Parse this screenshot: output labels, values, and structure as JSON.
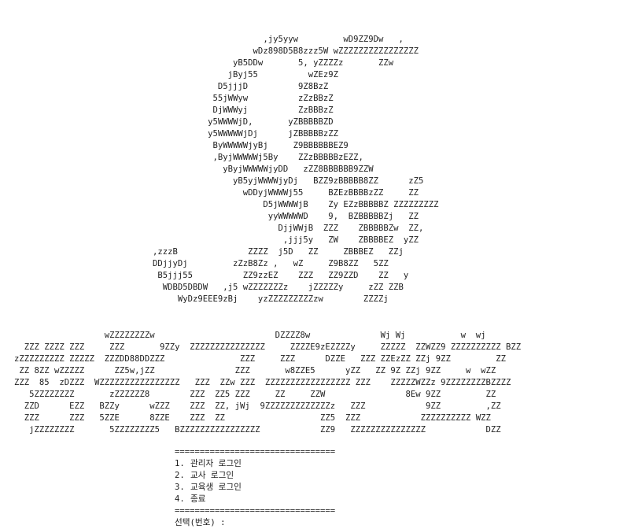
{
  "art": {
    "sun": "                      ,jy5yyw         wD9ZZ9Dw   ,\n                    wDz898D5B8zzz5W wZZZZZZZZZZZZZZZZ\n                yB5DDw       5, yZZZZz       ZZw\n               jByj55          wZEz9Z\n             D5jjjD          9Z8BzZ\n            55jWWyw          zZzBBzZ\n            DjWWWyj          ZzBBBzZ\n           y5WWWWjD,       yZBBBBBZD\n           y5WWWWWjDj      jZBBBBBzZZ\n            ByWWWWWjyBj     Z9BBBBBBEZ9\n            ,ByjWWWWWj5By    ZZzBBBBBzEZZ,\n              yByjWWWWWjyDD   zZZ8BBBBBB9ZZW\n                yB5yjWWWWjyDj   BZZ9zBBBBB8ZZ      zZ5\n                  wDDyjWWWWj55     BZEzBBBBzZZ     ZZ\n                      D5jWWWWjB    Zy EZzBBBBBZ ZZZZZZZZZ\n                       yyWWWWWD    9,  BZBBBBBZj   ZZ\n                         DjjWWjB  ZZZ    ZBBBBBZw  ZZ,\n                          ,jjj5y   ZW    ZBBBBEZ  yZZ\n,zzzB              ZZZZ  j5D   ZZ     ZBBBEZ   ZZj\nDDjjyDj         zZzB8Zz ,   wZ     Z9B8ZZ   5ZZ\n B5jjj55          ZZ9zzEZ    ZZZ   ZZ9ZZD    ZZ   y\n  WDBD5DBDW   ,j5 wZZZZZZZz    jZZZZZy     zZZ ZZB\n     WyDz9EEE9zBj    yzZZZZZZZZZzw        ZZZZj",
    "banner": "                  wZZZZZZZZw                        DZZZZ8w              Wj Wj           w  wj\n  ZZZ ZZZZ ZZZ     ZZZ       9ZZy  ZZZZZZZZZZZZZZZ     ZZZZE9zEZZZZy     ZZZZZ  ZZWZZ9 ZZZZZZZZZZ BZZ\nzZZZZZZZZZ ZZZZZ  ZZZDD88DDZZZ               ZZZ     ZZZ      DZZE   ZZZ ZZEzZZ ZZj 9ZZ         ZZ\n ZZ 8ZZ wZZZZZ      ZZ5w,jZZ                ZZZ       w8ZZE5      yZZ   ZZ 9Z ZZj 9ZZ     w  wZZ\nZZZ  85  zDZZZ  WZZZZZZZZZZZZZZZZ   ZZZ  ZZw ZZZ  ZZZZZZZZZZZZZZZZZ ZZZ    ZZZZZWZZz 9ZZZZZZZZBZZZZ\n   5ZZZZZZZZ       zZZZZZZ8        ZZZ  ZZ5 ZZZ     ZZ     ZZW                8Ew 9ZZ         ZZ\n  ZZD      EZZ   BZZy      wZZZ    ZZZ  ZZ, jWj  9ZZZZZZZZZZZZZz   ZZZ            9ZZ         ,ZZ\n  ZZZ      ZZZ   5ZZE      8ZZE    ZZZ  ZZ                   ZZ5  ZZZ            ZZZZZZZZZZ WZZ\n   jZZZZZZZZ       5ZZZZZZZZ5   BZZZZZZZZZZZZZZZZ            ZZ9   ZZZZZZZZZZZZZZZ            DZZ"
  },
  "menu": {
    "separator_top": "================================",
    "items": [
      {
        "number": "1.",
        "label": "관리자 로그인"
      },
      {
        "number": "2.",
        "label": "교사 로그인"
      },
      {
        "number": "3.",
        "label": "교육생 로그인"
      },
      {
        "number": "4.",
        "label": "종료"
      }
    ],
    "separator_bottom": "================================",
    "prompt_label": "선택(번호) :",
    "input_value": ""
  }
}
